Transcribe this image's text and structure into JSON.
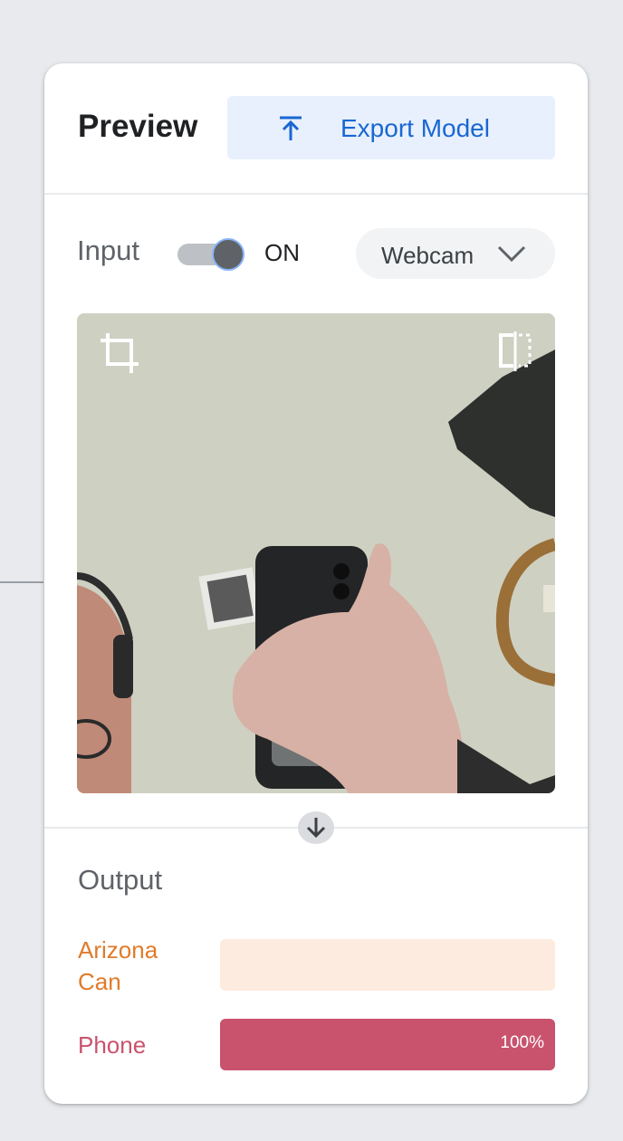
{
  "header": {
    "title": "Preview",
    "export_label": "Export Model"
  },
  "input": {
    "label": "Input",
    "toggle_state": "ON",
    "source": "Webcam"
  },
  "icons": {
    "export": "upload-arrow-icon",
    "crop": "crop-icon",
    "flip": "flip-horizontal-icon",
    "flow_down": "arrow-down-icon",
    "dropdown": "chevron-down-icon"
  },
  "output": {
    "title": "Output",
    "classes": [
      {
        "name": "Arizona Can",
        "confidence": 0.0,
        "percent_label": "",
        "color": "#e07b2a",
        "bg": "#fcebde"
      },
      {
        "name": "Phone",
        "confidence": 1.0,
        "percent_label": "100%",
        "color": "#c9536d",
        "bg": "#f6d7de"
      }
    ]
  },
  "colors": {
    "accent_blue": "#1967d2",
    "button_bg": "#e8f0fe",
    "page_bg": "#e8eaed"
  }
}
